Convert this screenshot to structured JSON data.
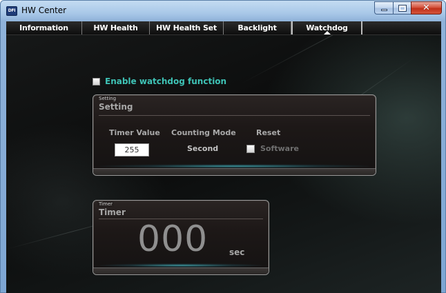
{
  "window": {
    "title": "HW Center",
    "logo_text": "DFI",
    "controls": {
      "minimize_icon": "minimize-icon",
      "maximize_icon": "maximize-icon",
      "close_icon": "close-icon",
      "close_glyph": "✕"
    }
  },
  "tabs": [
    {
      "label": "Information",
      "active": false
    },
    {
      "label": "HW Health",
      "active": false
    },
    {
      "label": "HW Health Set",
      "active": false
    },
    {
      "label": "Backlight",
      "active": false
    },
    {
      "label": "Watchdog",
      "active": true
    }
  ],
  "watchdog": {
    "enable_label": "Enable watchdog function",
    "enable_checked": false,
    "setting_panel": {
      "small_title": "Setting",
      "title": "Setting",
      "timer_value_label": "Timer Value",
      "timer_value": "255",
      "counting_mode_label": "Counting Mode",
      "counting_mode_value": "Second",
      "reset_label": "Reset",
      "software_label": "Software",
      "software_checked": false
    },
    "timer_panel": {
      "small_title": "Timer",
      "title": "Timer",
      "display": "000",
      "unit": "sec"
    }
  },
  "colors": {
    "accent_teal": "#3ec3b6",
    "panel_dark": "#1d1817",
    "close_red": "#c0301a"
  }
}
